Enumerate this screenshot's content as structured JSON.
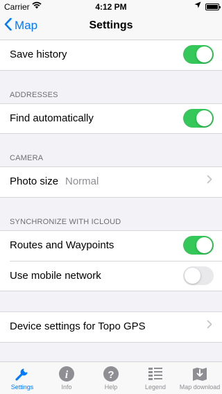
{
  "status_bar": {
    "carrier": "Carrier",
    "time": "4:12 PM"
  },
  "nav": {
    "back_label": "Map",
    "title": "Settings"
  },
  "sections": {
    "history": {
      "save_history": {
        "label": "Save history",
        "on": true
      }
    },
    "addresses": {
      "header": "ADDRESSES",
      "find_automatically": {
        "label": "Find automatically",
        "on": true
      }
    },
    "camera": {
      "header": "CAMERA",
      "photo_size": {
        "label": "Photo size",
        "value": "Normal"
      }
    },
    "icloud": {
      "header": "SYNCHRONIZE WITH ICLOUD",
      "routes_waypoints": {
        "label": "Routes and Waypoints",
        "on": true
      },
      "mobile_network": {
        "label": "Use mobile network",
        "on": false
      }
    },
    "device": {
      "device_settings": {
        "label": "Device settings for Topo GPS"
      }
    }
  },
  "tabbar": {
    "settings": "Settings",
    "info": "Info",
    "help": "Help",
    "legend": "Legend",
    "map_download": "Map download"
  },
  "colors": {
    "accent": "#007aff",
    "toggle_on": "#34c759",
    "toggle_off": "#e9e9eb"
  }
}
